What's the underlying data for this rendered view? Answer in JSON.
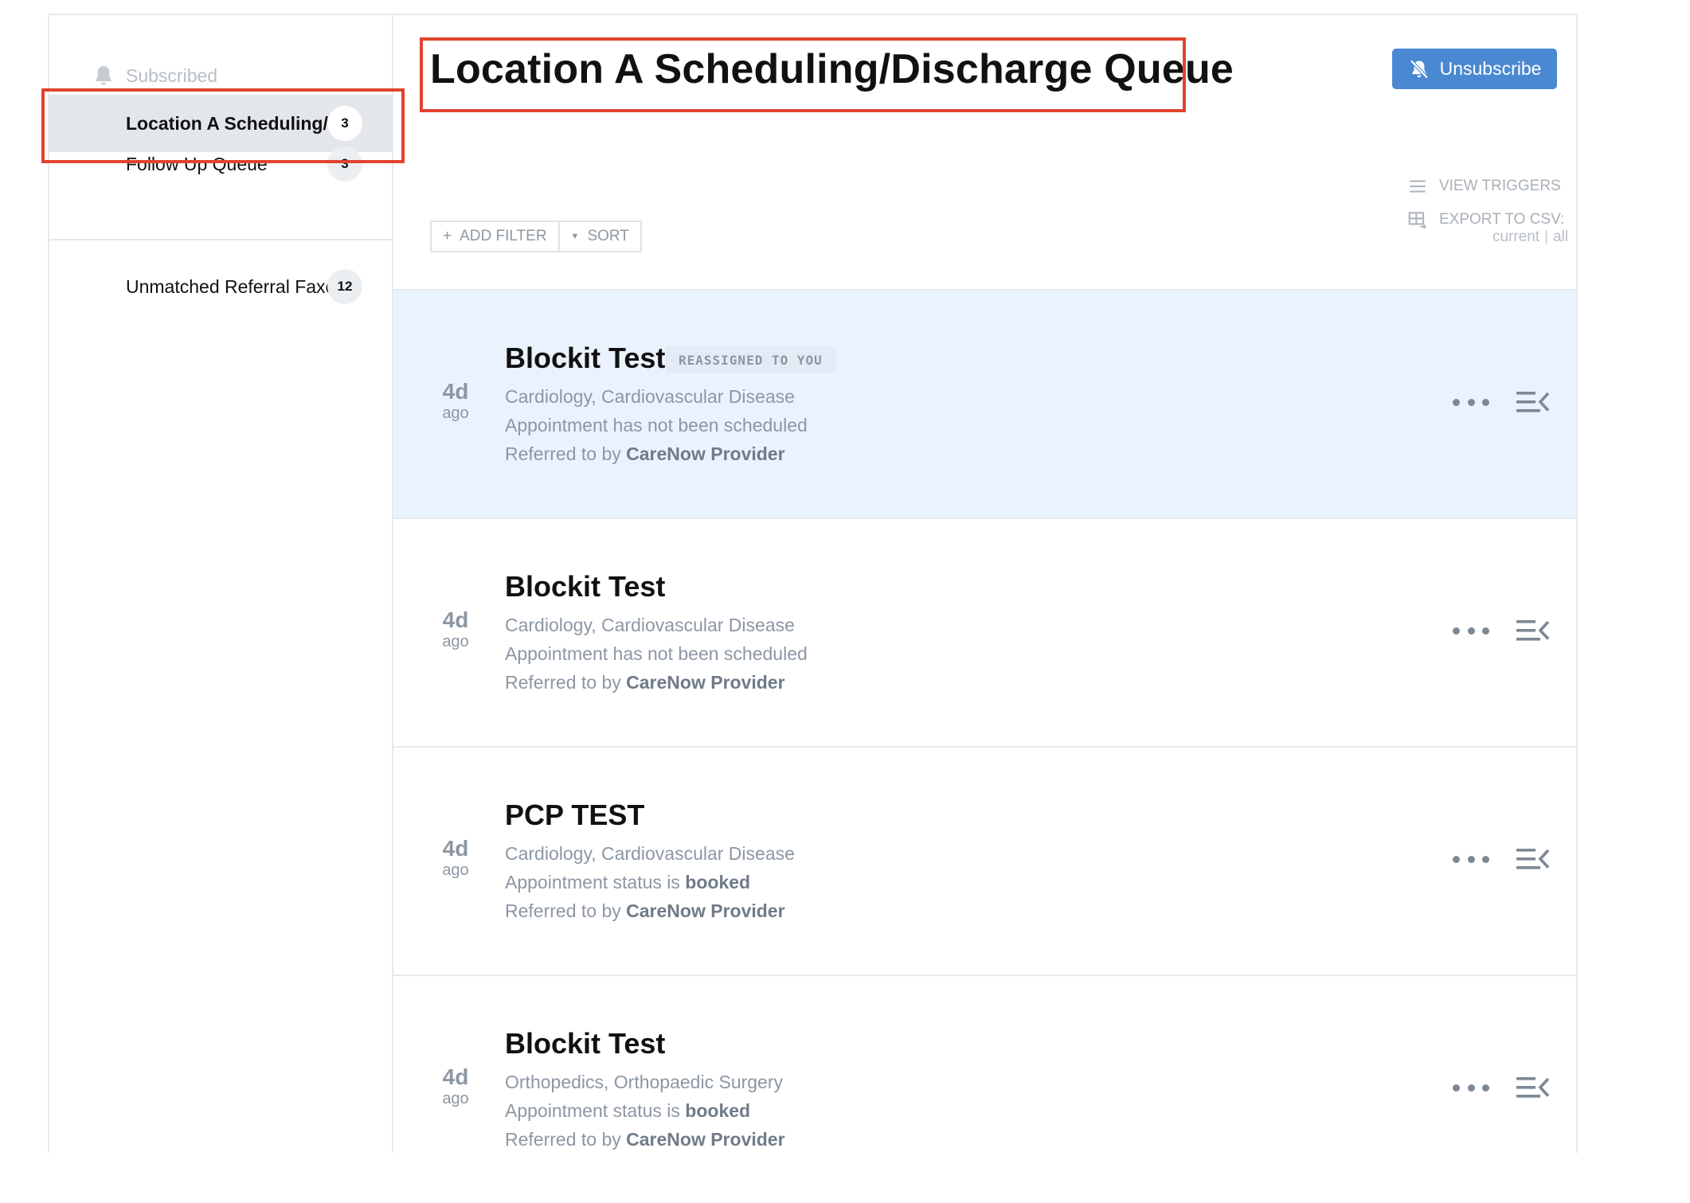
{
  "sidebar": {
    "subscribed_label": "Subscribed",
    "queues": [
      {
        "name": "Location A Scheduling/Discharge Queue",
        "count": "3",
        "active": true
      },
      {
        "name": "Follow Up Queue",
        "count": "3",
        "active": false
      }
    ],
    "other_queues": [
      {
        "name": "Unmatched Referral Faxes",
        "count": "12"
      }
    ]
  },
  "header": {
    "title": "Location A Scheduling/Discharge Queue",
    "unsubscribe_label": "Unsubscribe"
  },
  "actions": {
    "view_triggers": "VIEW TRIGGERS",
    "export_csv": "EXPORT TO CSV:",
    "export_current": "current",
    "export_separator": "|",
    "export_all": "all"
  },
  "filters": {
    "add_filter": "ADD FILTER",
    "sort": "SORT"
  },
  "referrals": [
    {
      "age_num": "4d",
      "age_unit": "ago",
      "title": "Blockit Test",
      "badge": "REASSIGNED TO YOU",
      "specialty": "Cardiology, Cardiovascular Disease",
      "status_text": "Appointment has not been scheduled",
      "status_value": "",
      "referred_prefix": "Referred to by ",
      "referred_by": "CareNow Provider"
    },
    {
      "age_num": "4d",
      "age_unit": "ago",
      "title": "Blockit Test",
      "badge": "",
      "specialty": "Cardiology, Cardiovascular Disease",
      "status_text": "Appointment has not been scheduled",
      "status_value": "",
      "referred_prefix": "Referred to by ",
      "referred_by": "CareNow Provider"
    },
    {
      "age_num": "4d",
      "age_unit": "ago",
      "title": "PCP TEST",
      "badge": "",
      "specialty": "Cardiology, Cardiovascular Disease",
      "status_text": "Appointment status is ",
      "status_value": "booked",
      "referred_prefix": "Referred to by ",
      "referred_by": "CareNow Provider"
    },
    {
      "age_num": "4d",
      "age_unit": "ago",
      "title": "Blockit Test",
      "badge": "",
      "specialty": "Orthopedics, Orthopaedic Surgery",
      "status_text": "Appointment status is ",
      "status_value": "booked",
      "referred_prefix": "Referred to by ",
      "referred_by": "CareNow Provider"
    }
  ],
  "colors": {
    "accent": "#4a88d1",
    "highlight": "#e1432f",
    "selected_row": "#eaf3fd",
    "active_nav": "#e3e7ec"
  }
}
